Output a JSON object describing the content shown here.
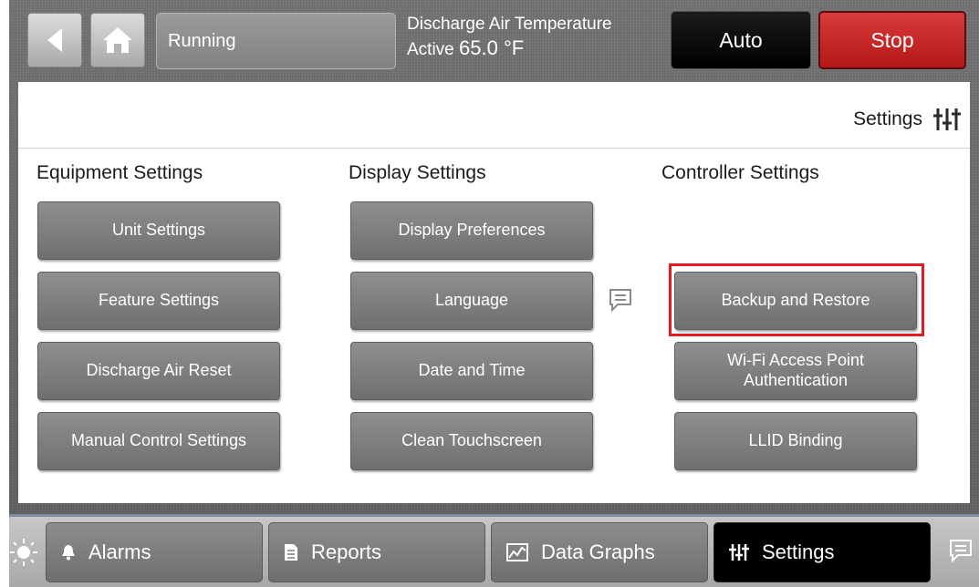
{
  "topbar": {
    "status": "Running",
    "temp_label": "Discharge Air Temperature",
    "temp_state": "Active",
    "temp_value": "65.0 °F",
    "auto_label": "Auto",
    "stop_label": "Stop"
  },
  "panel": {
    "title": "Settings",
    "columns": [
      {
        "heading": "Equipment Settings",
        "buttons": [
          "Unit Settings",
          "Feature Settings",
          "Discharge Air Reset",
          "Manual Control Settings"
        ]
      },
      {
        "heading": "Display Settings",
        "buttons": [
          "Display Preferences",
          "Language",
          "Date and Time",
          "Clean Touchscreen"
        ]
      },
      {
        "heading": "Controller Settings",
        "buttons": [
          "Backup and Restore",
          "Wi-Fi Access Point Authentication",
          "LLID Binding"
        ]
      }
    ]
  },
  "bottombar": {
    "tabs": [
      {
        "label": "Alarms",
        "icon": "bell-icon"
      },
      {
        "label": "Reports",
        "icon": "document-icon"
      },
      {
        "label": "Data Graphs",
        "icon": "chart-icon"
      },
      {
        "label": "Settings",
        "icon": "sliders-icon"
      }
    ]
  },
  "colors": {
    "stop": "#c62828",
    "highlight": "#e11b22",
    "button": "#7f7f7f"
  }
}
